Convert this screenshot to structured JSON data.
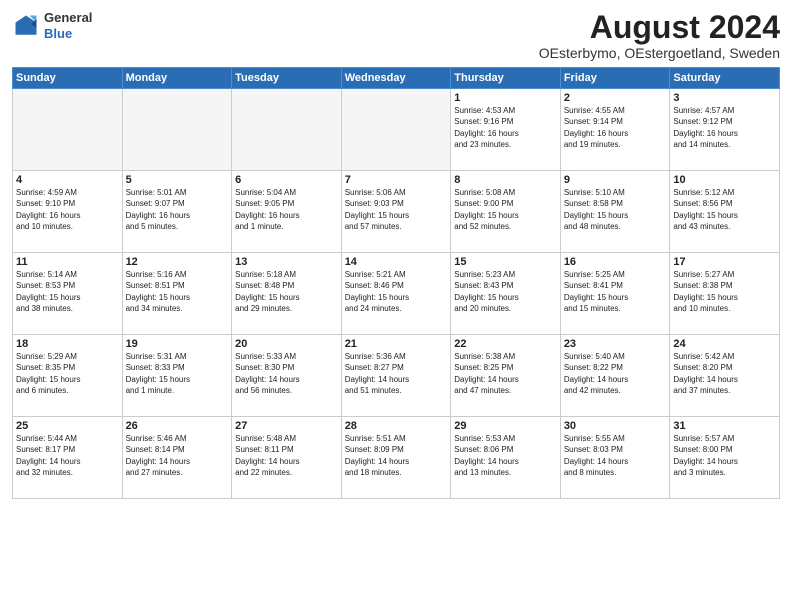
{
  "header": {
    "title": "August 2024",
    "subtitle": "OEsterbymo, OEstergoetland, Sweden",
    "logo_line1": "General",
    "logo_line2": "Blue"
  },
  "weekdays": [
    "Sunday",
    "Monday",
    "Tuesday",
    "Wednesday",
    "Thursday",
    "Friday",
    "Saturday"
  ],
  "weeks": [
    [
      {
        "day": "",
        "info": ""
      },
      {
        "day": "",
        "info": ""
      },
      {
        "day": "",
        "info": ""
      },
      {
        "day": "",
        "info": ""
      },
      {
        "day": "1",
        "info": "Sunrise: 4:53 AM\nSunset: 9:16 PM\nDaylight: 16 hours\nand 23 minutes."
      },
      {
        "day": "2",
        "info": "Sunrise: 4:55 AM\nSunset: 9:14 PM\nDaylight: 16 hours\nand 19 minutes."
      },
      {
        "day": "3",
        "info": "Sunrise: 4:57 AM\nSunset: 9:12 PM\nDaylight: 16 hours\nand 14 minutes."
      }
    ],
    [
      {
        "day": "4",
        "info": "Sunrise: 4:59 AM\nSunset: 9:10 PM\nDaylight: 16 hours\nand 10 minutes."
      },
      {
        "day": "5",
        "info": "Sunrise: 5:01 AM\nSunset: 9:07 PM\nDaylight: 16 hours\nand 5 minutes."
      },
      {
        "day": "6",
        "info": "Sunrise: 5:04 AM\nSunset: 9:05 PM\nDaylight: 16 hours\nand 1 minute."
      },
      {
        "day": "7",
        "info": "Sunrise: 5:06 AM\nSunset: 9:03 PM\nDaylight: 15 hours\nand 57 minutes."
      },
      {
        "day": "8",
        "info": "Sunrise: 5:08 AM\nSunset: 9:00 PM\nDaylight: 15 hours\nand 52 minutes."
      },
      {
        "day": "9",
        "info": "Sunrise: 5:10 AM\nSunset: 8:58 PM\nDaylight: 15 hours\nand 48 minutes."
      },
      {
        "day": "10",
        "info": "Sunrise: 5:12 AM\nSunset: 8:56 PM\nDaylight: 15 hours\nand 43 minutes."
      }
    ],
    [
      {
        "day": "11",
        "info": "Sunrise: 5:14 AM\nSunset: 8:53 PM\nDaylight: 15 hours\nand 38 minutes."
      },
      {
        "day": "12",
        "info": "Sunrise: 5:16 AM\nSunset: 8:51 PM\nDaylight: 15 hours\nand 34 minutes."
      },
      {
        "day": "13",
        "info": "Sunrise: 5:18 AM\nSunset: 8:48 PM\nDaylight: 15 hours\nand 29 minutes."
      },
      {
        "day": "14",
        "info": "Sunrise: 5:21 AM\nSunset: 8:46 PM\nDaylight: 15 hours\nand 24 minutes."
      },
      {
        "day": "15",
        "info": "Sunrise: 5:23 AM\nSunset: 8:43 PM\nDaylight: 15 hours\nand 20 minutes."
      },
      {
        "day": "16",
        "info": "Sunrise: 5:25 AM\nSunset: 8:41 PM\nDaylight: 15 hours\nand 15 minutes."
      },
      {
        "day": "17",
        "info": "Sunrise: 5:27 AM\nSunset: 8:38 PM\nDaylight: 15 hours\nand 10 minutes."
      }
    ],
    [
      {
        "day": "18",
        "info": "Sunrise: 5:29 AM\nSunset: 8:35 PM\nDaylight: 15 hours\nand 6 minutes."
      },
      {
        "day": "19",
        "info": "Sunrise: 5:31 AM\nSunset: 8:33 PM\nDaylight: 15 hours\nand 1 minute."
      },
      {
        "day": "20",
        "info": "Sunrise: 5:33 AM\nSunset: 8:30 PM\nDaylight: 14 hours\nand 56 minutes."
      },
      {
        "day": "21",
        "info": "Sunrise: 5:36 AM\nSunset: 8:27 PM\nDaylight: 14 hours\nand 51 minutes."
      },
      {
        "day": "22",
        "info": "Sunrise: 5:38 AM\nSunset: 8:25 PM\nDaylight: 14 hours\nand 47 minutes."
      },
      {
        "day": "23",
        "info": "Sunrise: 5:40 AM\nSunset: 8:22 PM\nDaylight: 14 hours\nand 42 minutes."
      },
      {
        "day": "24",
        "info": "Sunrise: 5:42 AM\nSunset: 8:20 PM\nDaylight: 14 hours\nand 37 minutes."
      }
    ],
    [
      {
        "day": "25",
        "info": "Sunrise: 5:44 AM\nSunset: 8:17 PM\nDaylight: 14 hours\nand 32 minutes."
      },
      {
        "day": "26",
        "info": "Sunrise: 5:46 AM\nSunset: 8:14 PM\nDaylight: 14 hours\nand 27 minutes."
      },
      {
        "day": "27",
        "info": "Sunrise: 5:48 AM\nSunset: 8:11 PM\nDaylight: 14 hours\nand 22 minutes."
      },
      {
        "day": "28",
        "info": "Sunrise: 5:51 AM\nSunset: 8:09 PM\nDaylight: 14 hours\nand 18 minutes."
      },
      {
        "day": "29",
        "info": "Sunrise: 5:53 AM\nSunset: 8:06 PM\nDaylight: 14 hours\nand 13 minutes."
      },
      {
        "day": "30",
        "info": "Sunrise: 5:55 AM\nSunset: 8:03 PM\nDaylight: 14 hours\nand 8 minutes."
      },
      {
        "day": "31",
        "info": "Sunrise: 5:57 AM\nSunset: 8:00 PM\nDaylight: 14 hours\nand 3 minutes."
      }
    ]
  ]
}
